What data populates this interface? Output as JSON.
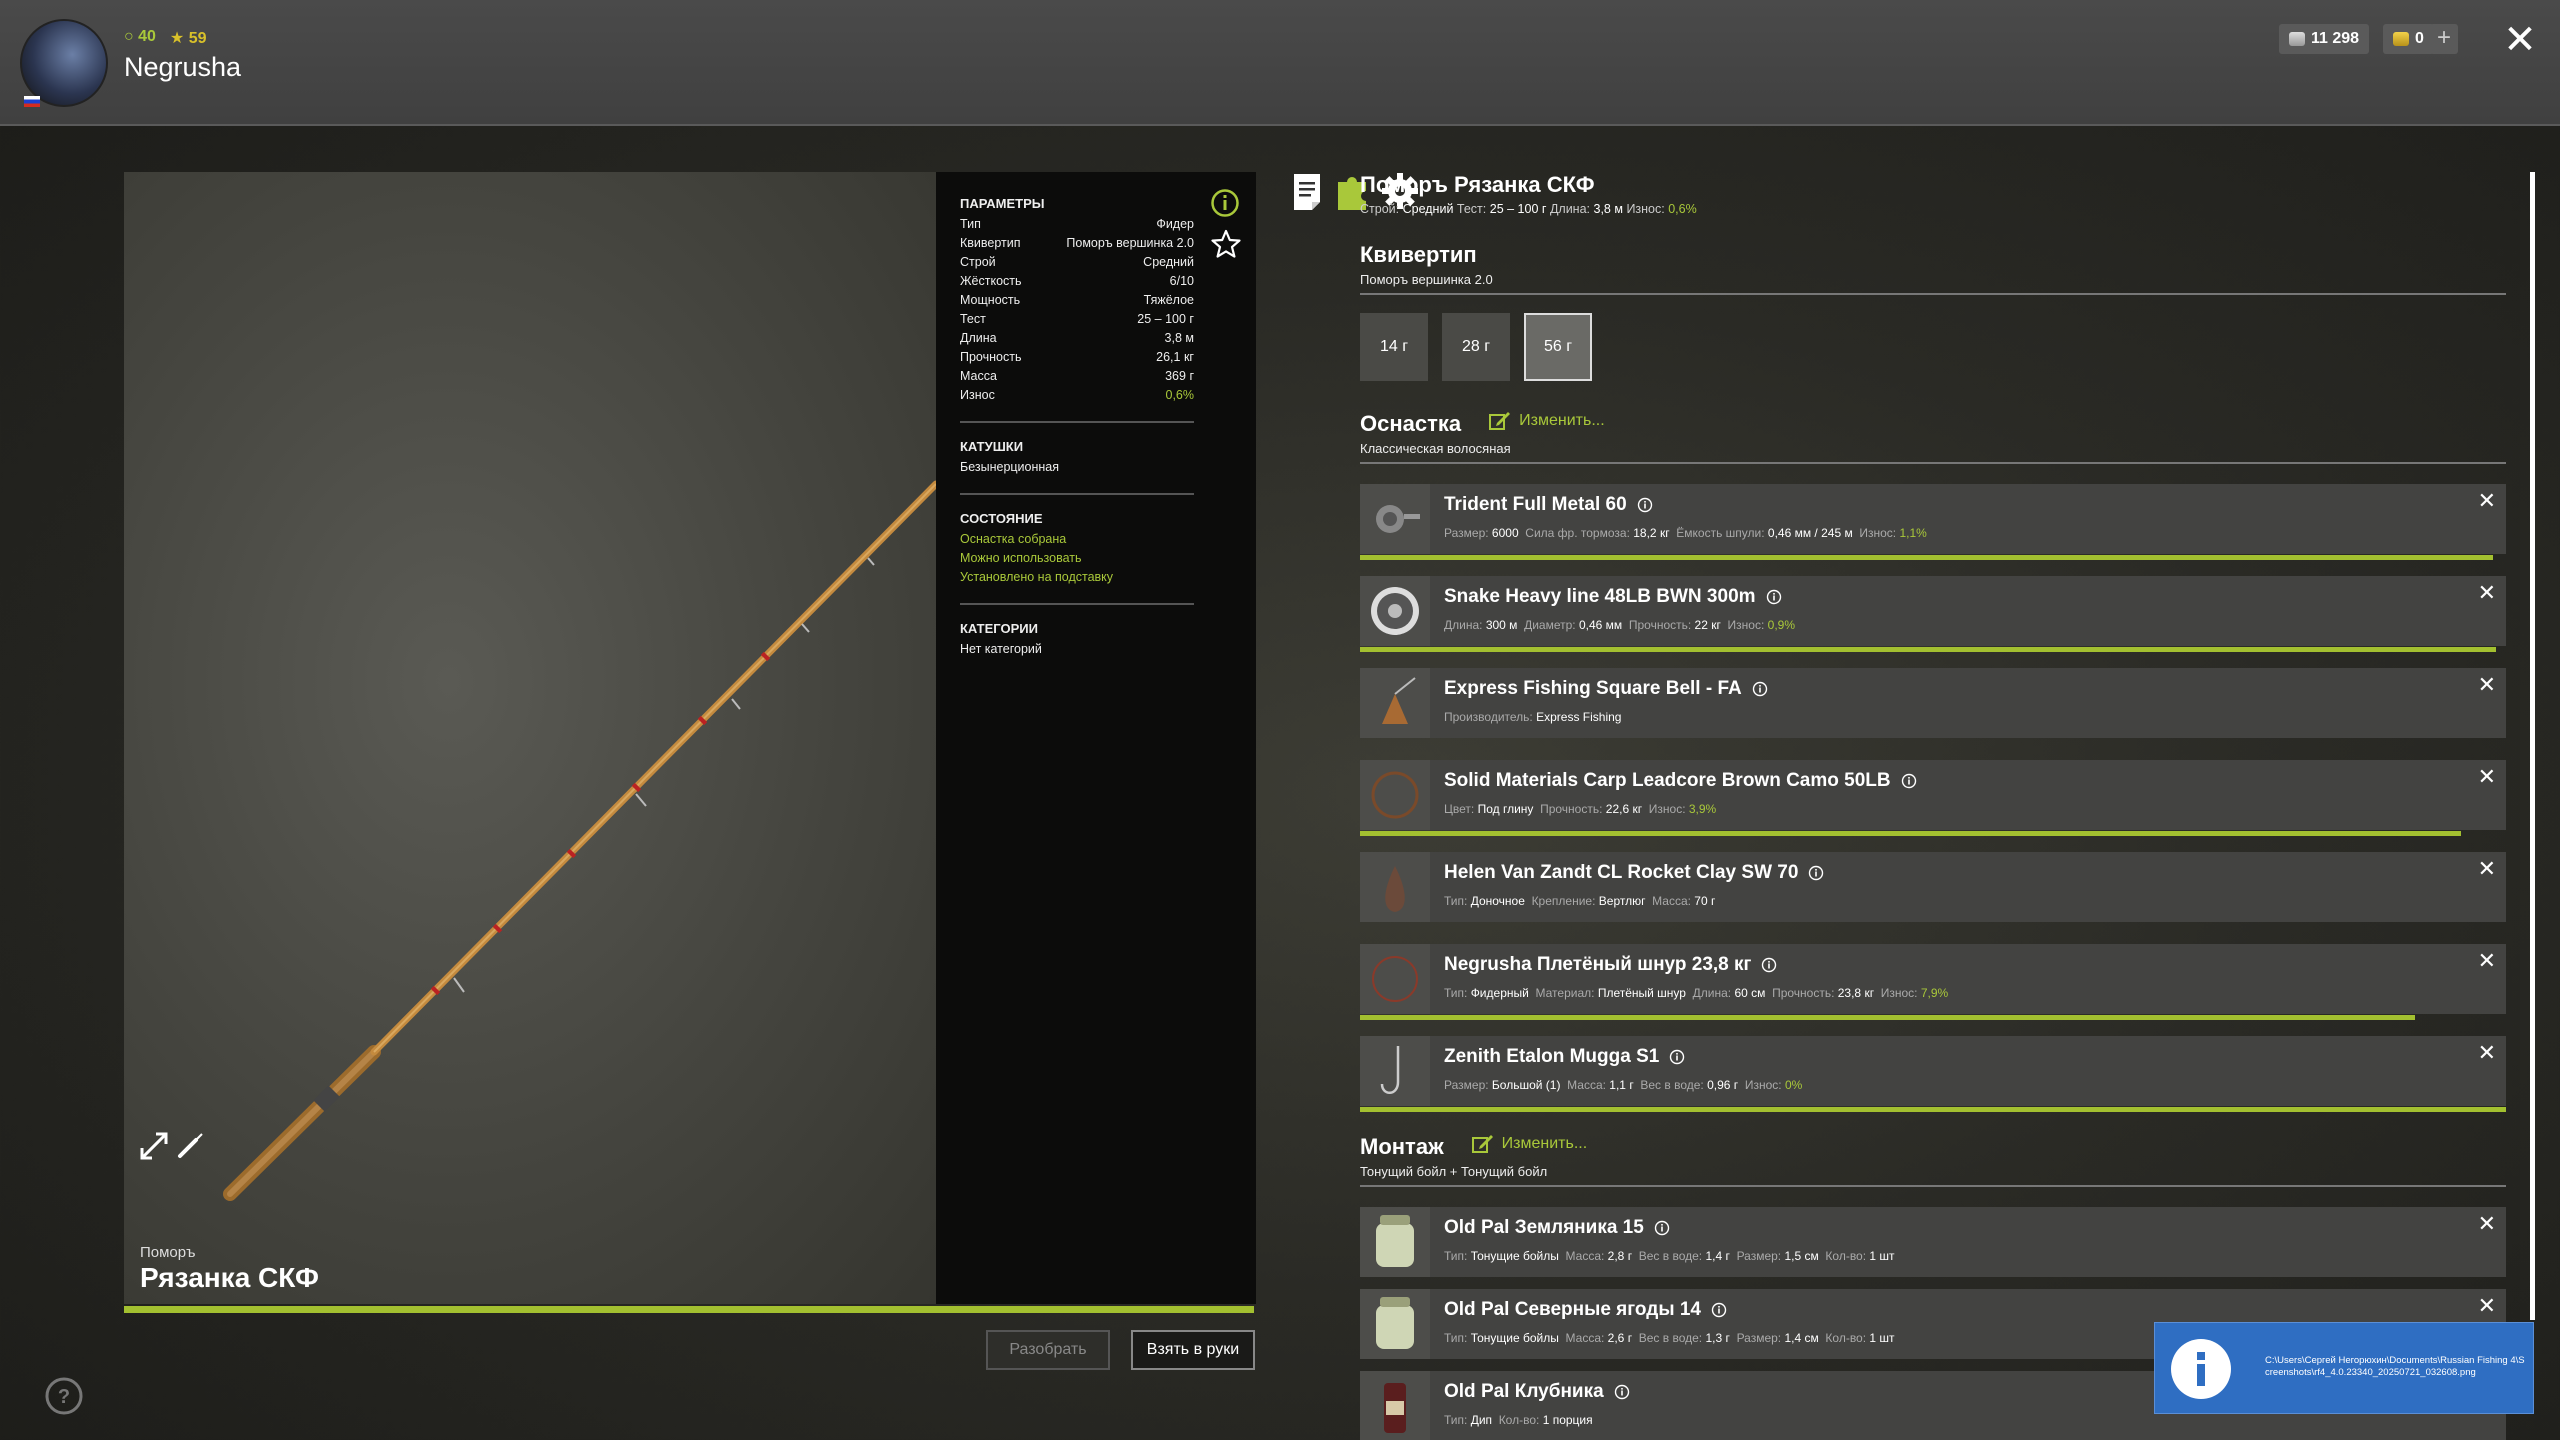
{
  "player": {
    "name": "Negrusha",
    "stat_green": "40",
    "stat_yellow": "59",
    "silver": "11 298",
    "gold": "0"
  },
  "rod": {
    "brand": "Поморъ",
    "name": "Рязанка СКФ"
  },
  "params": {
    "title": "ПАРАМЕТРЫ",
    "rows": [
      {
        "label": "Тип",
        "value": "Фидер"
      },
      {
        "label": "Квивертип",
        "value": "Поморъ вершинка 2.0"
      },
      {
        "label": "Строй",
        "value": "Средний"
      },
      {
        "label": "Жёсткость",
        "value": "6/10"
      },
      {
        "label": "Мощность",
        "value": "Тяжёлое"
      },
      {
        "label": "Тест",
        "value": "25 – 100 г"
      },
      {
        "label": "Длина",
        "value": "3,8 м"
      },
      {
        "label": "Прочность",
        "value": "26,1 кг"
      },
      {
        "label": "Масса",
        "value": "369 г"
      },
      {
        "label": "Износ",
        "value": "0,6%"
      }
    ],
    "reels_title": "КАТУШКИ",
    "reels_value": "Безынерционная",
    "state_title": "СОСТОЯНИЕ",
    "state_items": [
      "Оснастка собрана",
      "Можно использовать",
      "Установлено на подставку"
    ],
    "categories_title": "КАТЕГОРИИ",
    "categories_value": "Нет категорий"
  },
  "buttons": {
    "disassemble": "Разобрать",
    "take": "Взять в руки"
  },
  "details": {
    "title": "Поморъ Рязанка СКФ",
    "sub": {
      "build_label": "Строй:",
      "build": "Средний",
      "test_label": "Тест:",
      "test": "25 – 100 г",
      "length_label": "Длина:",
      "length": "3,8 м",
      "wear_label": "Износ:",
      "wear": "0,6%"
    },
    "quiver_title": "Квивертип",
    "quiver_sub": "Поморъ вершинка 2.0",
    "quiver_options": [
      "14 г",
      "28 г",
      "56 г"
    ],
    "rig_title": "Оснастка",
    "rig_edit": "Изменить...",
    "rig_sub": "Классическая волосяная",
    "montage_title": "Монтаж",
    "montage_edit": "Изменить...",
    "montage_sub": "Тонущий бойл + Тонущий бойл"
  },
  "rig_items": [
    {
      "name": "Trident Full Metal 60",
      "meta": [
        [
          "Размер:",
          "6000"
        ],
        [
          "Сила фр. тормоза:",
          "18,2 кг"
        ],
        [
          "Ёмкость шпули:",
          "0,46 мм / 245 м"
        ],
        [
          "Износ:",
          "1,1%",
          "green"
        ]
      ],
      "wear": 0.989
    },
    {
      "name": "Snake Heavy line 48LB BWN 300m",
      "meta": [
        [
          "Длина:",
          "300 м"
        ],
        [
          "Диаметр:",
          "0,46 мм"
        ],
        [
          "Прочность:",
          "22 кг"
        ],
        [
          "Износ:",
          "0,9%",
          "green"
        ]
      ],
      "wear": 0.991
    },
    {
      "name": "Express Fishing Square Bell - FA",
      "meta": [
        [
          "Производитель:",
          "Express Fishing"
        ]
      ],
      "wear": null
    },
    {
      "name": "Solid Materials Carp Leadcore Brown Camo 50LB",
      "meta": [
        [
          "Цвет:",
          "Под глину"
        ],
        [
          "Прочность:",
          "22,6 кг"
        ],
        [
          "Износ:",
          "3,9%",
          "green"
        ]
      ],
      "wear": 0.961
    },
    {
      "name": "Helen Van Zandt CL Rocket Clay SW 70",
      "meta": [
        [
          "Тип:",
          "Доночное"
        ],
        [
          "Крепление:",
          "Вертлюг"
        ],
        [
          "Масса:",
          "70 г"
        ]
      ],
      "wear": null
    },
    {
      "name": "Negrusha Плетёный шнур 23,8 кг",
      "meta": [
        [
          "Тип:",
          "Фидерный"
        ],
        [
          "Материал:",
          "Плетёный шнур"
        ],
        [
          "Длина:",
          "60 см"
        ],
        [
          "Прочность:",
          "23,8 кг"
        ],
        [
          "Износ:",
          "7,9%",
          "green"
        ]
      ],
      "wear": 0.921
    },
    {
      "name": "Zenith Etalon Mugga S1",
      "meta": [
        [
          "Размер:",
          "Большой (1)"
        ],
        [
          "Масса:",
          "1,1 г"
        ],
        [
          "Вес в воде:",
          "0,96 г"
        ],
        [
          "Износ:",
          "0%",
          "green"
        ]
      ],
      "wear": 1.0
    }
  ],
  "montage_items": [
    {
      "name": "Old Pal Земляника 15",
      "meta": [
        [
          "Тип:",
          "Тонущие бойлы"
        ],
        [
          "Масса:",
          "2,8 г"
        ],
        [
          "Вес в воде:",
          "1,4 г"
        ],
        [
          "Размер:",
          "1,5 см"
        ],
        [
          "Кол-во:",
          "1 шт"
        ]
      ]
    },
    {
      "name": "Old Pal Северные ягоды 14",
      "meta": [
        [
          "Тип:",
          "Тонущие бойлы"
        ],
        [
          "Масса:",
          "2,6 г"
        ],
        [
          "Вес в воде:",
          "1,3 г"
        ],
        [
          "Размер:",
          "1,4 см"
        ],
        [
          "Кол-во:",
          "1 шт"
        ]
      ]
    },
    {
      "name": "Old Pal Клубника",
      "meta": [
        [
          "Тип:",
          "Дип"
        ],
        [
          "Кол-во:",
          "1 порция"
        ]
      ]
    }
  ],
  "notification": {
    "text": "C:\\Users\\Сергей Негорюхин\\Documents\\Russian Fishing 4\\Screenshots\\rf4_4.0.23340_20250721_032608.png"
  },
  "colors": {
    "accent": "#a9c83a",
    "panel": "#434341",
    "notify": "#2f6ec2"
  }
}
